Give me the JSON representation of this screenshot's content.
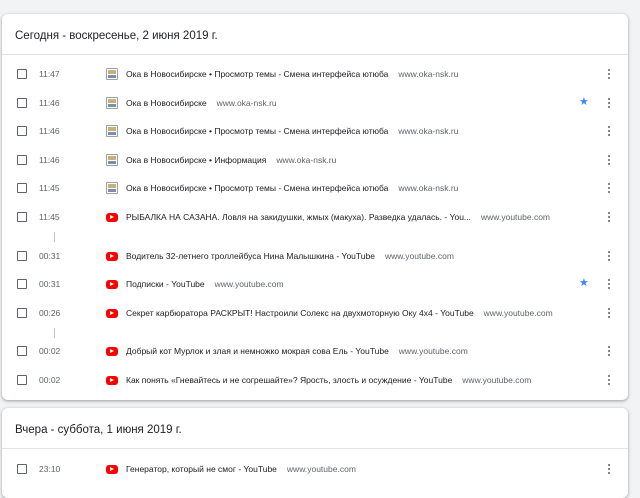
{
  "sections": [
    {
      "header": "Сегодня - воскресенье, 2 июня 2019 г.",
      "rows": [
        {
          "time": "11:47",
          "icon": "oka-favicon",
          "title": "Ока в Новосибирске • Просмотр темы - Смена интерфейса ютюба",
          "domain": "www.oka-nsk.ru",
          "starred": false
        },
        {
          "time": "11:46",
          "icon": "oka-favicon",
          "title": "Ока в Новосибирске",
          "domain": "www.oka-nsk.ru",
          "starred": true
        },
        {
          "time": "11:46",
          "icon": "oka-favicon",
          "title": "Ока в Новосибирске • Просмотр темы - Смена интерфейса ютюба",
          "domain": "www.oka-nsk.ru",
          "starred": false
        },
        {
          "time": "11:46",
          "icon": "oka-favicon",
          "title": "Ока в Новосибирске • Информация",
          "domain": "www.oka-nsk.ru",
          "starred": false
        },
        {
          "time": "11:45",
          "icon": "oka-favicon",
          "title": "Ока в Новосибирске • Просмотр темы - Смена интерфейса ютюба",
          "domain": "www.oka-nsk.ru",
          "starred": false
        },
        {
          "time": "11:45",
          "icon": "youtube-favicon",
          "title": "РЫБАЛКА НА САЗАНА. Ловля на закидушки, жмых (макуха). Разведка удалась. - You...",
          "domain": "www.youtube.com",
          "starred": false
        },
        {
          "time": "00:31",
          "icon": "youtube-favicon",
          "title": "Водитель 32-летнего троллейбуса Нина Малышкина - YouTube",
          "domain": "www.youtube.com",
          "starred": false
        },
        {
          "time": "00:31",
          "icon": "youtube-favicon",
          "title": "Подписки - YouTube",
          "domain": "www.youtube.com",
          "starred": true
        },
        {
          "time": "00:26",
          "icon": "youtube-favicon",
          "title": "Секрет карбюратора РАСКРЫТ! Настроили Солекс на двухмоторную Оку 4х4 - YouTube",
          "domain": "www.youtube.com",
          "starred": false
        },
        {
          "time": "00:02",
          "icon": "youtube-favicon",
          "title": "Добрый кот Мурлок и злая и немножко мокрая сова Ель - YouTube",
          "domain": "www.youtube.com",
          "starred": false
        },
        {
          "time": "00:02",
          "icon": "youtube-favicon",
          "title": "Как понять «Гневайтесь и не согрешайте»? Ярость, злость и осуждение - YouTube",
          "domain": "www.youtube.com",
          "starred": false
        }
      ]
    },
    {
      "header": "Вчера - суббота, 1 июня 2019 г.",
      "rows": [
        {
          "time": "23:10",
          "icon": "youtube-favicon",
          "title": "Генератор, который не смог - YouTube",
          "domain": "www.youtube.com",
          "starred": false
        }
      ]
    }
  ],
  "colors": {
    "star": "#4285f4",
    "youtube": "#ff0000",
    "background": "#f1f3f4"
  }
}
